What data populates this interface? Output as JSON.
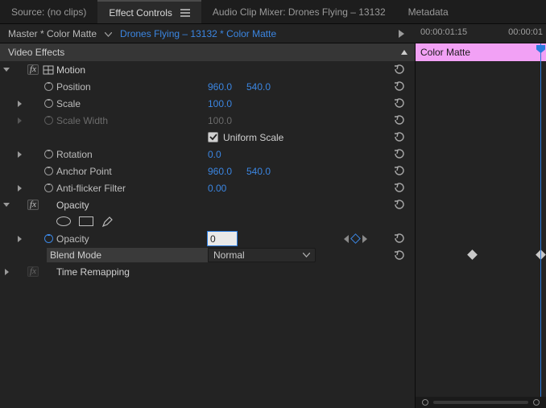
{
  "tabs": {
    "source": "Source: (no clips)",
    "effect": "Effect Controls",
    "mixer": "Audio Clip Mixer: Drones Flying – 13132",
    "meta": "Metadata"
  },
  "clip": {
    "master": "Master * Color Matte",
    "sequence": "Drones Flying – 13132 * Color Matte"
  },
  "section": {
    "video_effects": "Video Effects"
  },
  "motion": {
    "label": "Motion",
    "position": {
      "label": "Position",
      "x": "960.0",
      "y": "540.0"
    },
    "scale": {
      "label": "Scale",
      "v": "100.0"
    },
    "scale_width": {
      "label": "Scale Width",
      "v": "100.0"
    },
    "uniform": {
      "label": "Uniform Scale"
    },
    "rotation": {
      "label": "Rotation",
      "v": "0.0"
    },
    "anchor": {
      "label": "Anchor Point",
      "x": "960.0",
      "y": "540.0"
    },
    "flicker": {
      "label": "Anti-flicker Filter",
      "v": "0.00"
    }
  },
  "opacity": {
    "label": "Opacity",
    "op": {
      "label": "Opacity",
      "value": "0"
    },
    "blend": {
      "label": "Blend Mode",
      "value": "Normal"
    }
  },
  "time": {
    "label": "Time Remapping"
  },
  "timeline": {
    "tick1": "00:00:01:15",
    "tick2": "00:00:01",
    "track": "Color Matte"
  }
}
